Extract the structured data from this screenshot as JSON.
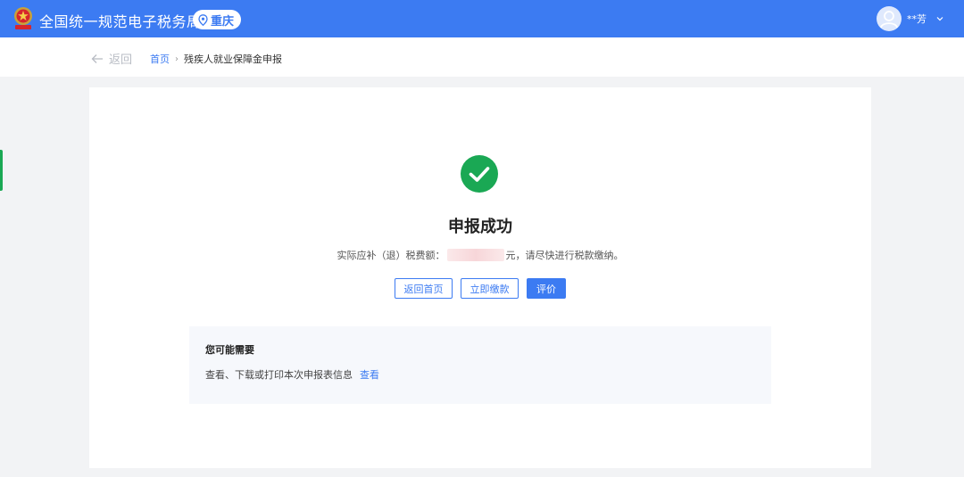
{
  "header": {
    "site_title": "全国统一规范电子税务局",
    "region": "重庆",
    "user_name": "**芳",
    "icons": {
      "logo": "tax-emblem-icon",
      "region": "location-pin-icon",
      "avatar": "user-avatar-icon",
      "menu": "chevron-down-icon"
    }
  },
  "nav": {
    "back_label": "返回",
    "breadcrumb": {
      "home": "首页",
      "separator": "›",
      "current": "残疾人就业保障金申报"
    }
  },
  "result": {
    "title": "申报成功",
    "amount_prefix": "实际应补（退）税费额：",
    "amount_value": "",
    "amount_suffix": "元，请尽快进行税款缴纳。",
    "buttons": {
      "home": "返回首页",
      "pay": "立即缴款",
      "rate": "评价"
    }
  },
  "suggest": {
    "title": "您可能需要",
    "text": "查看、下载或打印本次申报表信息",
    "link": "查看"
  },
  "colors": {
    "primary": "#3c7bf2",
    "success": "#1aa854",
    "page_bg": "#f2f3f5"
  }
}
